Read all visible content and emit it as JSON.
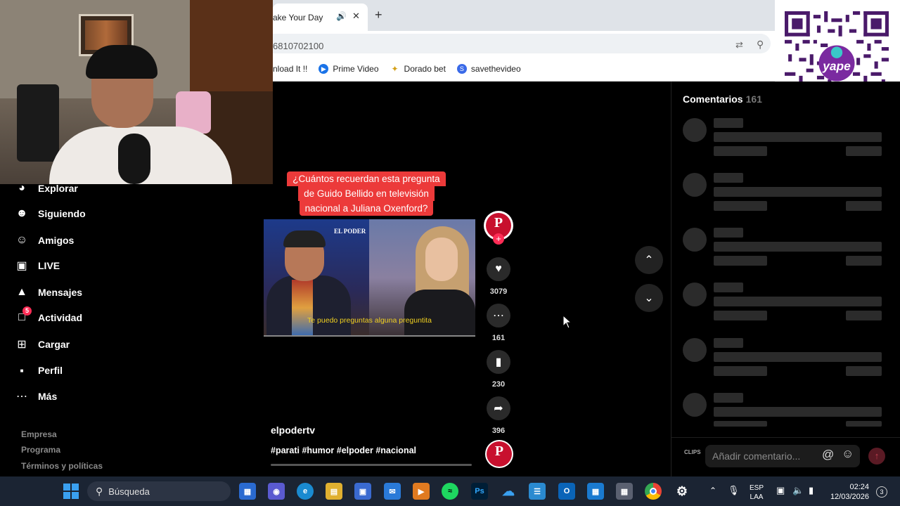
{
  "browser": {
    "tab_title": "ake Your Day",
    "address": "6810702100",
    "bookmarks": [
      {
        "label": "nload It !!",
        "icon": "download-icon",
        "color": "#ffffff"
      },
      {
        "label": "Prime Video",
        "icon": "prime-video-icon",
        "color": "#1a73e8"
      },
      {
        "label": "Dorado bet",
        "icon": "dorado-bet-icon",
        "color": "#d4a017"
      },
      {
        "label": "savethevideo",
        "icon": "savethevideo-icon",
        "color": "#3a6ae8"
      }
    ]
  },
  "sidebar": {
    "items": [
      {
        "label": "Explorar",
        "icon": "compass-icon"
      },
      {
        "label": "Siguiendo",
        "icon": "following-icon"
      },
      {
        "label": "Amigos",
        "icon": "friends-icon"
      },
      {
        "label": "LIVE",
        "icon": "live-icon"
      },
      {
        "label": "Mensajes",
        "icon": "messages-icon"
      },
      {
        "label": "Actividad",
        "icon": "activity-icon",
        "badge": "5"
      },
      {
        "label": "Cargar",
        "icon": "upload-icon"
      },
      {
        "label": "Perfil",
        "icon": "profile-icon"
      },
      {
        "label": "Más",
        "icon": "more-icon"
      }
    ],
    "footer": [
      "Empresa",
      "Programa",
      "Términos y políticas"
    ]
  },
  "video": {
    "caption_lines": [
      "¿Cuántos recuerdan esta pregunta",
      "de Guido Bellido en televisión",
      "nacional a Juliana Oxenford?"
    ],
    "thumb_logo": "EL PODER",
    "thumb_subtitle": "Te puedo preguntas alguna preguntita",
    "username": "elpodertv",
    "hashtags": "#parati #humor #elpoder #nacional",
    "avatar_letter": "P",
    "avatar_small": "EL PODER",
    "likes": "3079",
    "comments": "161",
    "saves": "230",
    "shares": "396"
  },
  "comments_panel": {
    "title": "Comentarios",
    "count": "161",
    "input_placeholder": "Añadir comentario...",
    "clips_label": "CLIPS"
  },
  "qr": {
    "brand": "yape"
  },
  "taskbar": {
    "search_label": "Búsqueda",
    "lang_top": "ESP",
    "lang_bottom": "LAA",
    "time": "02:24",
    "date": "12/03/2026",
    "notifications": "3"
  },
  "colors": {
    "tiktok_red": "#fe2c55",
    "caption_bg": "#ec3a3a",
    "el_poder_red": "#c8102e",
    "taskbar_bg": "#1b2433"
  }
}
